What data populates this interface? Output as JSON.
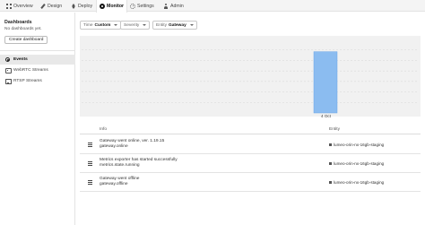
{
  "nav": {
    "tabs": [
      {
        "label": "Overview",
        "icon": "grid-icon"
      },
      {
        "label": "Design",
        "icon": "pencil-icon"
      },
      {
        "label": "Deploy",
        "icon": "rocket-icon"
      },
      {
        "label": "Monitor",
        "icon": "monitor-icon",
        "active": true
      },
      {
        "label": "Settings",
        "icon": "gear-icon"
      },
      {
        "label": "Admin",
        "icon": "admin-icon"
      }
    ]
  },
  "sidebar": {
    "title": "Dashboards",
    "empty_text": "No dashboards yet.",
    "create_button": "Create dashboard",
    "items": [
      {
        "label": "Events",
        "icon": "events-icon",
        "active": true
      },
      {
        "label": "WebRTC Streams",
        "icon": "webrtc-icon"
      },
      {
        "label": "RTSP Streams",
        "icon": "rtsp-icon"
      }
    ]
  },
  "filters": {
    "time": {
      "label": "Time",
      "value": "Custom"
    },
    "severity": {
      "label": "Severity"
    },
    "entity": {
      "label": "Entity",
      "value": "Gateway"
    }
  },
  "chart_data": {
    "type": "bar",
    "categories": [
      "4 Oct"
    ],
    "values": [
      3
    ],
    "ylim": [
      0,
      3.6
    ],
    "grid": true,
    "bar_color": "#8bbcf0",
    "background_color": "#f1f1f1"
  },
  "table": {
    "columns": {
      "info": "Info",
      "entity": "Entity"
    },
    "rows": [
      {
        "message": "Gateway went online, ver. 1.19.15",
        "type": "gateway.online",
        "entity": "lumeo-orin-nx-16gb-staging"
      },
      {
        "message": "Metrics exporter has started successfully",
        "type": "metrics.state.running",
        "entity": "lumeo-orin-nx-16gb-staging"
      },
      {
        "message": "Gateway went offline",
        "type": "gateway.offline",
        "entity": "lumeo-orin-nx-16gb-staging"
      }
    ]
  }
}
